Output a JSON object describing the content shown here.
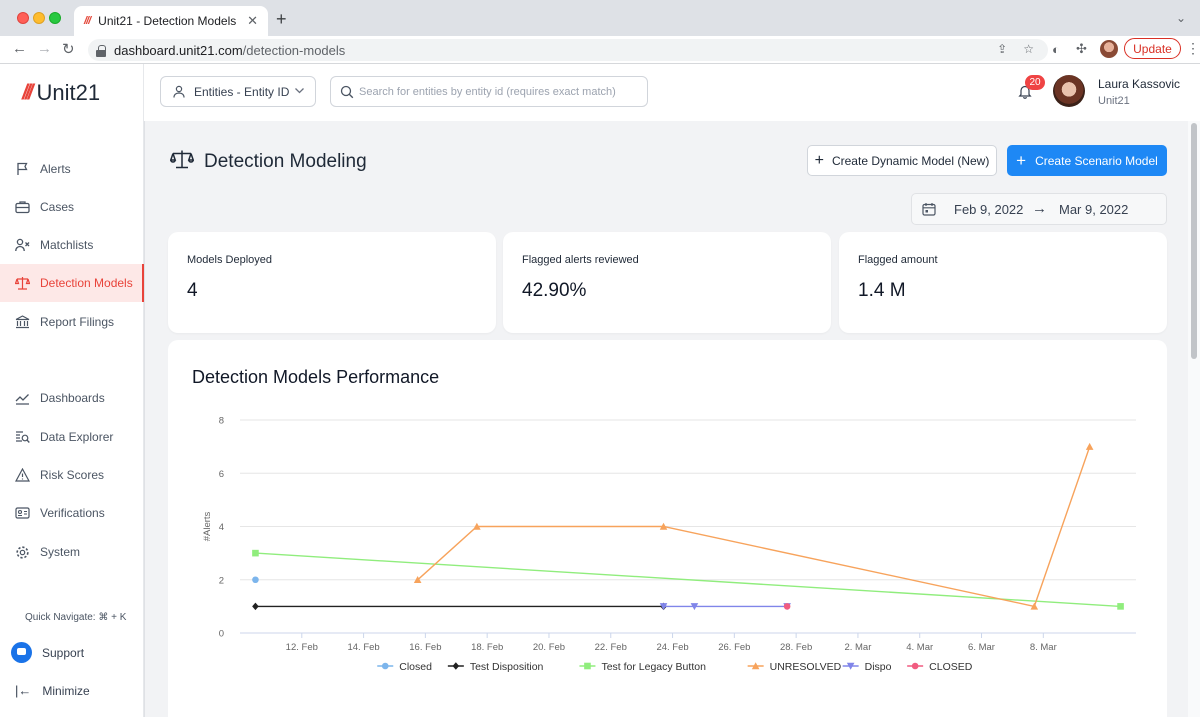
{
  "browser": {
    "tab_title": "Unit21 - Detection Models",
    "url_host": "dashboard.unit21.com",
    "url_path": "/detection-models",
    "update_label": "Update"
  },
  "sidebar": {
    "logo_text": "Unit21",
    "items": [
      {
        "label": "Alerts",
        "icon": "flag-icon"
      },
      {
        "label": "Cases",
        "icon": "briefcase-icon"
      },
      {
        "label": "Matchlists",
        "icon": "user-x-icon"
      },
      {
        "label": "Detection Models",
        "icon": "scale-icon",
        "active": true
      },
      {
        "label": "Report Filings",
        "icon": "bank-icon"
      },
      {
        "label": "Dashboards",
        "icon": "trend-icon"
      },
      {
        "label": "Data Explorer",
        "icon": "data-search-icon"
      },
      {
        "label": "Risk Scores",
        "icon": "warning-icon"
      },
      {
        "label": "Verifications",
        "icon": "id-card-icon"
      },
      {
        "label": "System",
        "icon": "gear-icon"
      }
    ],
    "quick_navigate": "Quick Navigate: ⌘ + K",
    "support_label": "Support",
    "minimize_label": "Minimize"
  },
  "topbar": {
    "entity_select": "Entities - Entity ID",
    "search_placeholder": "Search for entities by entity id (requires exact match)",
    "notification_count": "20",
    "user_name": "Laura Kassovic",
    "user_org": "Unit21"
  },
  "page": {
    "title": "Detection Modeling",
    "btn_dynamic": "Create Dynamic Model (New)",
    "btn_scenario": "Create Scenario Model",
    "date_from": "Feb 9, 2022",
    "date_to": "Mar 9, 2022"
  },
  "stats": [
    {
      "label": "Models Deployed",
      "value": "4"
    },
    {
      "label": "Flagged alerts reviewed",
      "value": "42.90%"
    },
    {
      "label": "Flagged amount",
      "value": "1.4 M"
    }
  ],
  "colors": {
    "brand": "#e8433a",
    "primary": "#1e88f5"
  },
  "chart_data": {
    "type": "line",
    "title": "Detection Models Performance",
    "ylabel": "#Alerts",
    "xlabel": "",
    "ylim": [
      0,
      8
    ],
    "xlim": [
      "2022-02-10",
      "2022-03-11"
    ],
    "yticks": [
      0,
      2,
      4,
      6,
      8
    ],
    "xticks": [
      {
        "date": "2022-02-12",
        "label": "12. Feb"
      },
      {
        "date": "2022-02-14",
        "label": "14. Feb"
      },
      {
        "date": "2022-02-16",
        "label": "16. Feb"
      },
      {
        "date": "2022-02-18",
        "label": "18. Feb"
      },
      {
        "date": "2022-02-20",
        "label": "20. Feb"
      },
      {
        "date": "2022-02-22",
        "label": "22. Feb"
      },
      {
        "date": "2022-02-24",
        "label": "24. Feb"
      },
      {
        "date": "2022-02-26",
        "label": "26. Feb"
      },
      {
        "date": "2022-02-28",
        "label": "28. Feb"
      },
      {
        "date": "2022-03-02",
        "label": "2. Mar"
      },
      {
        "date": "2022-03-04",
        "label": "4. Mar"
      },
      {
        "date": "2022-03-06",
        "label": "6. Mar"
      },
      {
        "date": "2022-03-08",
        "label": "8. Mar"
      }
    ],
    "grid": true,
    "legend_position": "bottom-center",
    "series": [
      {
        "name": "Closed",
        "color": "#7cb5ec",
        "marker": "circle",
        "points": [
          {
            "x": "2022-02-10 12:00",
            "y": 2
          }
        ]
      },
      {
        "name": "Test Disposition",
        "color": "#222222",
        "marker": "diamond",
        "points": [
          {
            "x": "2022-02-10 12:00",
            "y": 1
          },
          {
            "x": "2022-02-23 17:00",
            "y": 1
          }
        ]
      },
      {
        "name": "Test for Legacy Button",
        "color": "#90ed7d",
        "marker": "square",
        "points": [
          {
            "x": "2022-02-10 12:00",
            "y": 3
          },
          {
            "x": "2022-03-10 12:00",
            "y": 1
          }
        ]
      },
      {
        "name": "UNRESOLVED",
        "color": "#f7a35c",
        "marker": "triangle",
        "points": [
          {
            "x": "2022-02-15 18:00",
            "y": 2
          },
          {
            "x": "2022-02-17 16:00",
            "y": 4
          },
          {
            "x": "2022-02-23 17:00",
            "y": 4
          },
          {
            "x": "2022-03-07 17:00",
            "y": 1
          },
          {
            "x": "2022-03-09 12:00",
            "y": 7
          }
        ]
      },
      {
        "name": "Dispo",
        "color": "#8085e9",
        "marker": "triangle-down",
        "points": [
          {
            "x": "2022-02-23 17:00",
            "y": 1
          },
          {
            "x": "2022-02-24 17:00",
            "y": 1
          },
          {
            "x": "2022-02-27 17:00",
            "y": 1
          }
        ]
      },
      {
        "name": "CLOSED",
        "color": "#f15c80",
        "marker": "circle",
        "points": [
          {
            "x": "2022-02-27 17:00",
            "y": 1
          }
        ]
      }
    ]
  }
}
